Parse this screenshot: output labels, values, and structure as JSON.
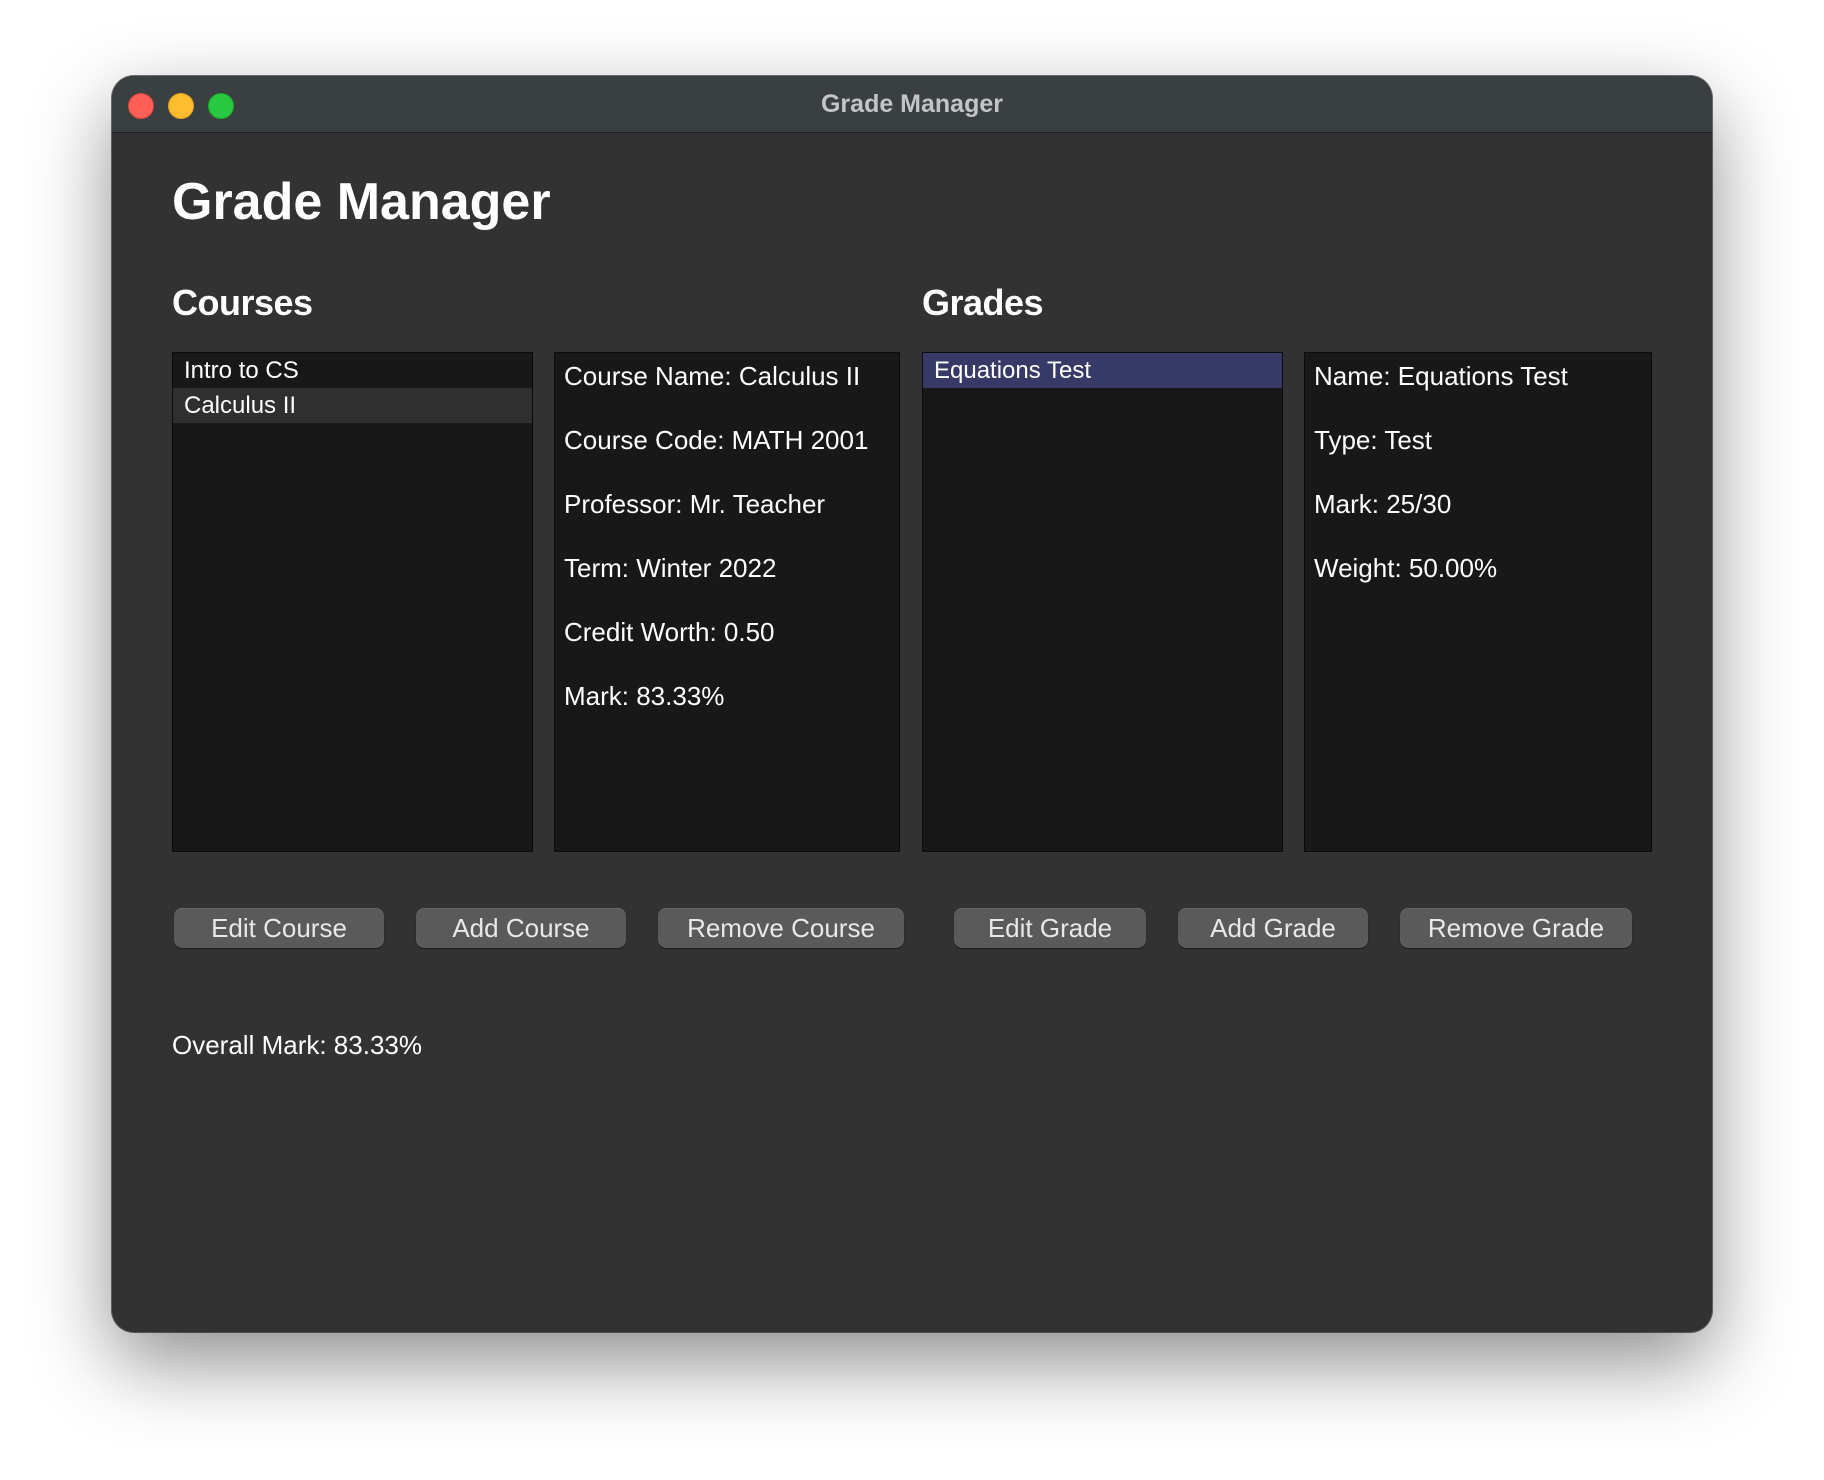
{
  "window": {
    "title": "Grade Manager"
  },
  "page": {
    "title": "Grade Manager"
  },
  "courses": {
    "heading": "Courses",
    "items": [
      "Intro to CS",
      "Calculus II"
    ],
    "selected": "Calculus II",
    "details": [
      "Course Name: Calculus II",
      "Course Code: MATH 2001",
      "Professor: Mr. Teacher",
      "Term: Winter 2022",
      "Credit Worth: 0.50",
      "Mark: 83.33%"
    ]
  },
  "grades": {
    "heading": "Grades",
    "items": [
      "Equations Test"
    ],
    "selected": "Equations Test",
    "details": [
      "Name: Equations Test",
      "Type: Test",
      "Mark: 25/30",
      "Weight: 50.00%"
    ]
  },
  "buttons": {
    "edit_course": "Edit Course",
    "add_course": "Add Course",
    "remove_course": "Remove Course",
    "edit_grade": "Edit Grade",
    "add_grade": "Add Grade",
    "remove_grade": "Remove Grade"
  },
  "overall_mark": "Overall Mark: 83.33%",
  "colors": {
    "window_bg": "#323232",
    "panel_bg": "#181818",
    "course_selection": "#2f2f2f",
    "grade_selection": "#373a66",
    "button_bg": "#5a5a5a",
    "close": "#ff5f57",
    "minimize": "#febc2e",
    "zoom": "#28c840"
  }
}
